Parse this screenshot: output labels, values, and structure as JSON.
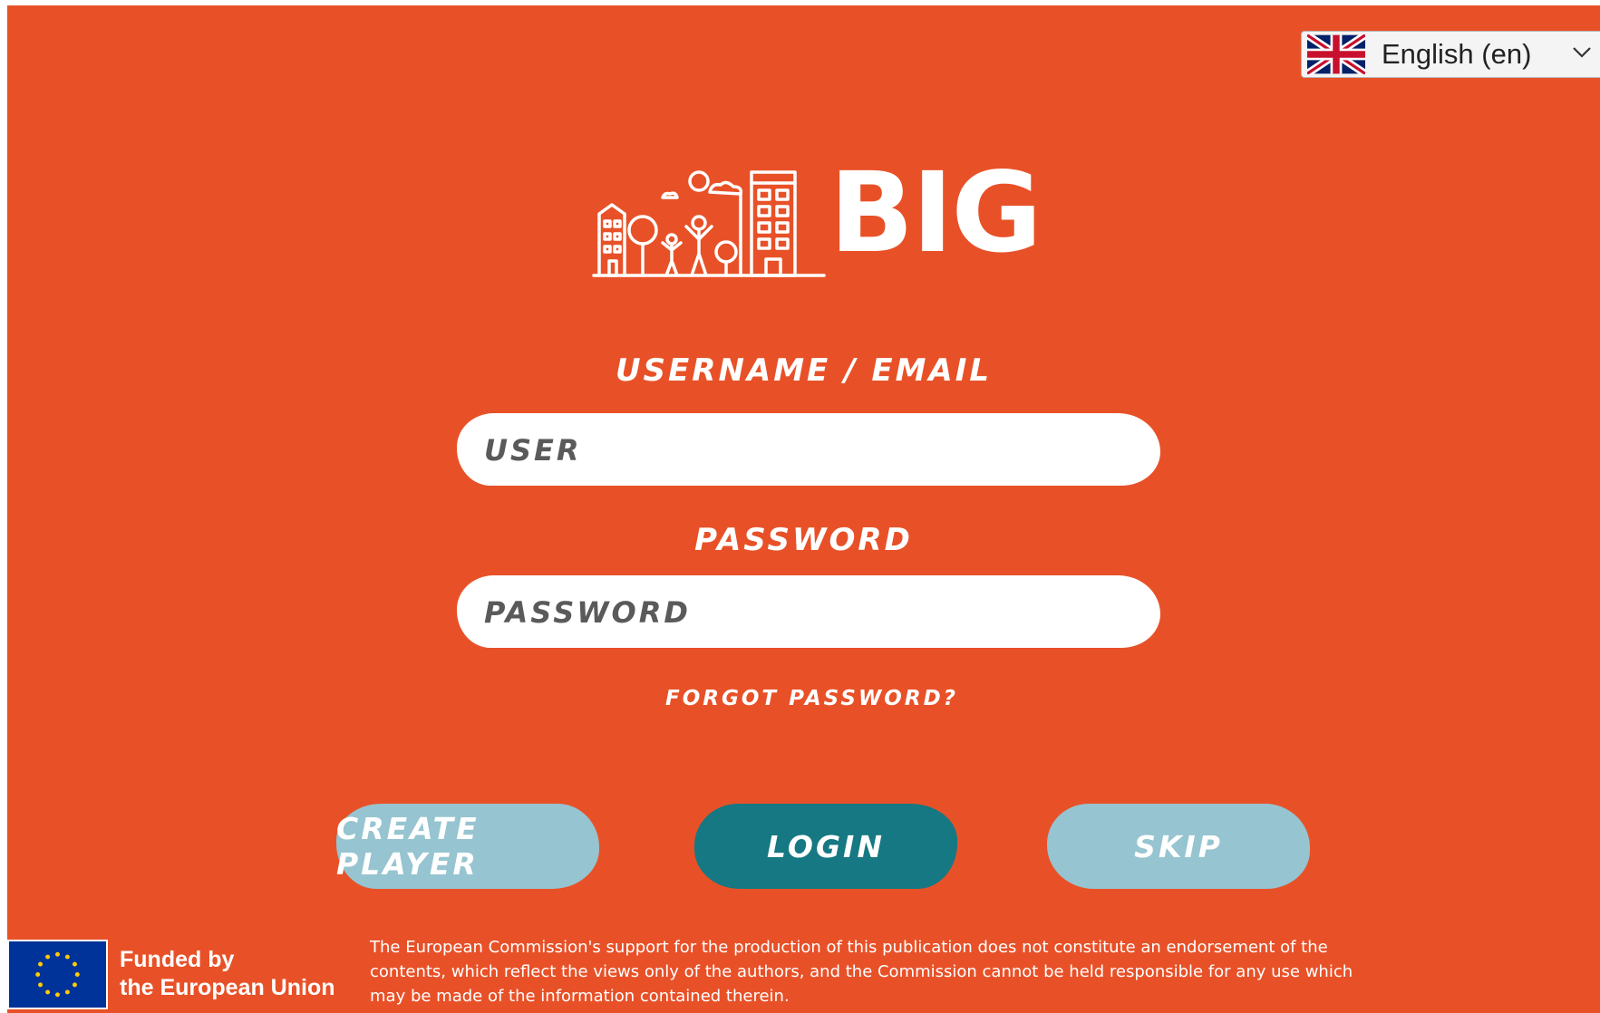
{
  "language_selector": {
    "flag_icon": "uk-flag-icon",
    "value": "English (en)"
  },
  "logo": {
    "text": "BIG",
    "icon": "city-skyline-icon"
  },
  "form": {
    "username_label": "USERNAME / EMAIL",
    "username_placeholder": "USER",
    "password_label": "PASSWORD",
    "password_placeholder": "PASSWORD",
    "forgot_password": "FORGOT PASSWORD?"
  },
  "buttons": {
    "create_player": "CREATE PLAYER",
    "login": "LOGIN",
    "skip": "SKIP"
  },
  "footer": {
    "eu_flag_icon": "eu-flag-icon",
    "funded_line1": "Funded by",
    "funded_line2": "the European Union",
    "disclaimer": "The European Commission's support for the production of this publication does not constitute an endorsement of the contents, which reflect the views only of the authors, and the Commission cannot be held responsible for any use which may be made of the information contained therein."
  },
  "colors": {
    "background": "#e85128",
    "login_button": "#157882",
    "secondary_button": "#96c4d1",
    "eu_blue": "#003399",
    "eu_yellow": "#ffcc00"
  }
}
